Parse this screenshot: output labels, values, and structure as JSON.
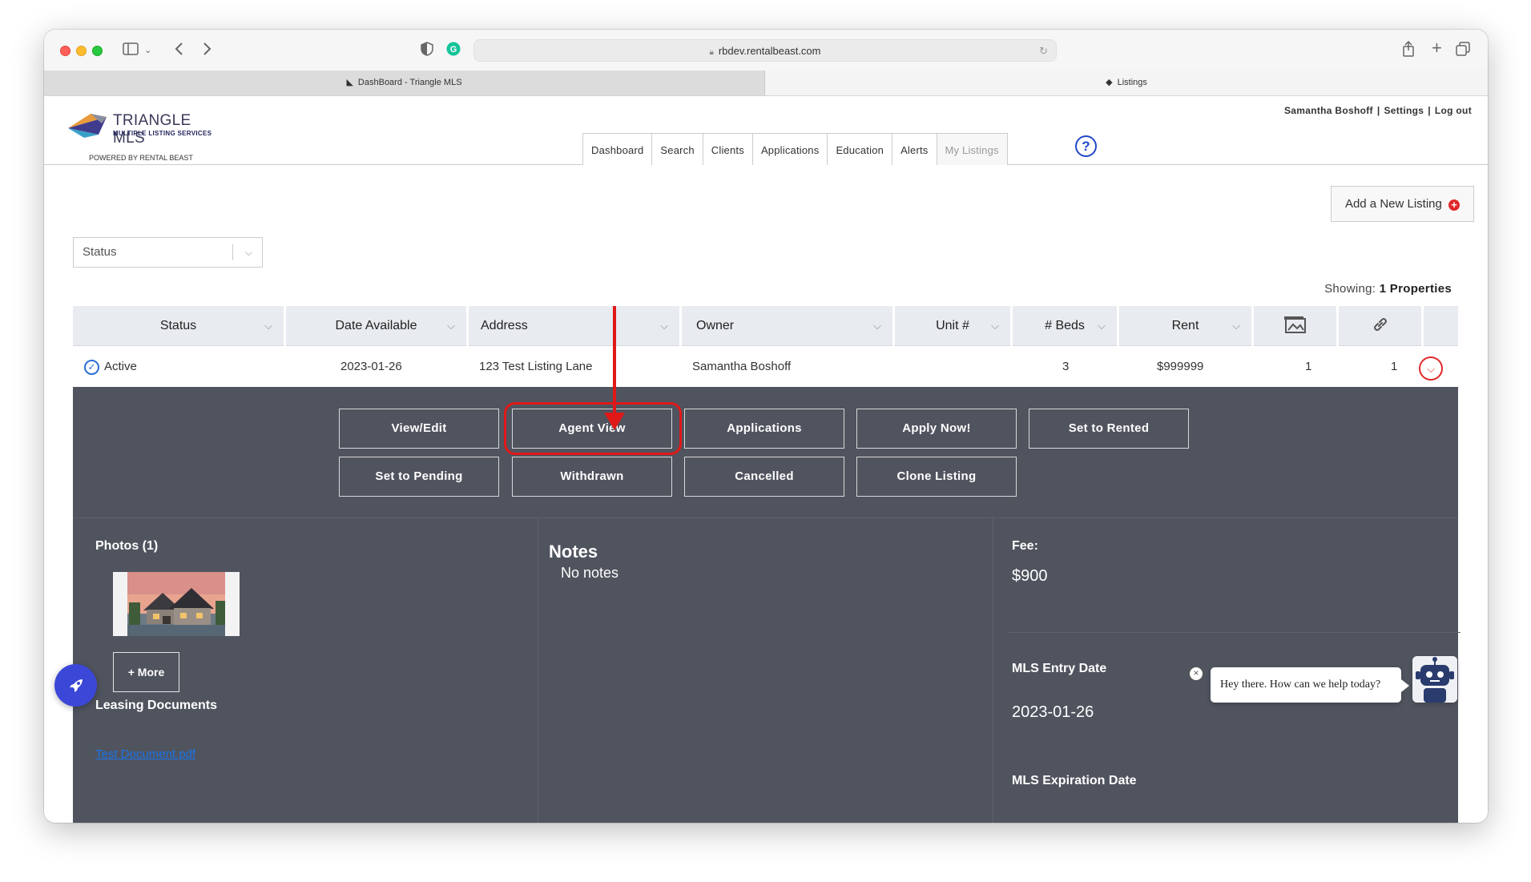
{
  "browser": {
    "url": "rbdev.rentalbeast.com",
    "tabs": [
      {
        "label": "DashBoard - Triangle MLS"
      },
      {
        "label": "Listings"
      }
    ]
  },
  "header": {
    "logo_title": "TRIANGLE MLS",
    "logo_subtitle": "MULTIPLE LISTING SERVICES",
    "powered_by": "POWERED BY RENTAL BEAST",
    "user_name": "Samantha Boshoff",
    "settings_label": "Settings",
    "logout_label": "Log out",
    "separator": "|"
  },
  "nav": {
    "items": [
      {
        "label": "Dashboard"
      },
      {
        "label": "Search"
      },
      {
        "label": "Clients"
      },
      {
        "label": "Applications"
      },
      {
        "label": "Education"
      },
      {
        "label": "Alerts"
      },
      {
        "label": "My Listings"
      }
    ],
    "help_label": "?"
  },
  "toolbar": {
    "add_listing_label": "Add a New Listing",
    "add_listing_plus": "+"
  },
  "filters": {
    "status_placeholder": "Status"
  },
  "summary": {
    "showing_label": "Showing:",
    "showing_count": "1 Properties"
  },
  "table": {
    "columns": [
      "Status",
      "Date Available",
      "Address",
      "Owner",
      "Unit #",
      "# Beds",
      "Rent"
    ],
    "row": {
      "status": "Active",
      "date_available": "2023-01-26",
      "address": "123 Test Listing Lane",
      "owner": "Samantha Boshoff",
      "unit": "",
      "beds": "3",
      "rent": "$999999",
      "photos": "1",
      "links": "1"
    }
  },
  "actions": {
    "row1": [
      "View/Edit",
      "Agent View",
      "Applications",
      "Apply Now!",
      "Set to Rented"
    ],
    "row2": [
      "Set to Pending",
      "Withdrawn",
      "Cancelled",
      "Clone Listing"
    ]
  },
  "details": {
    "photos_heading": "Photos (1)",
    "more_label": "+ More",
    "leasing_heading": "Leasing Documents",
    "document_link": "Test Document.pdf",
    "notes_heading": "Notes",
    "notes_text": "No notes",
    "fee_label": "Fee:",
    "fee_value": "$900",
    "entry_label": "MLS Entry Date",
    "entry_value": "2023-01-26",
    "expiration_label": "MLS Expiration Date"
  },
  "chat": {
    "message": "Hey there. How can we help today?"
  },
  "colors": {
    "panel_bg": "#50545f",
    "accent_red": "#e01818",
    "help_blue": "#2148c8",
    "rocket_blue": "#3b47d6"
  }
}
